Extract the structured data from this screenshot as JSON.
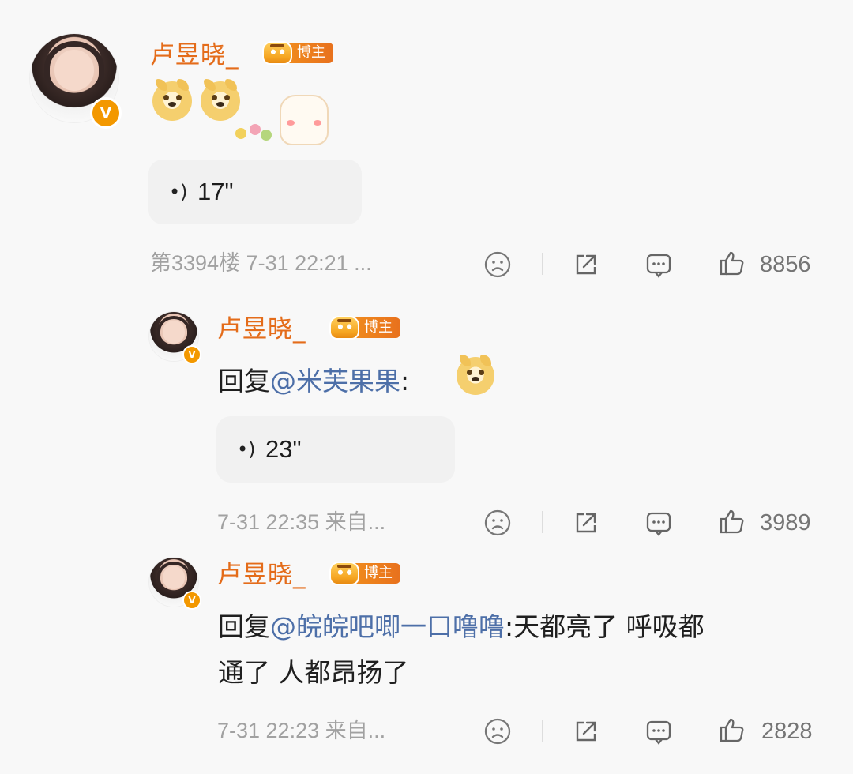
{
  "comments": [
    {
      "username": "卢昱晓_",
      "badge": "博主",
      "voice_duration": "17\"",
      "meta": "第3394楼 7-31 22:21 ...",
      "likes": "8856",
      "icons": [
        "dislike-icon",
        "share-icon",
        "comment-icon",
        "like-icon"
      ],
      "stickers": [
        "doge-emoji",
        "doge-emoji",
        "cat-sticker",
        "flower-sticker"
      ]
    },
    {
      "username": "卢昱晓_",
      "badge": "博主",
      "reply_prefix": "回复",
      "mention": "@米芙果果",
      "reply_tail": ":",
      "voice_duration": "23\"",
      "meta": "7-31 22:35 来自...",
      "likes": "3989",
      "icons": [
        "dislike-icon",
        "share-icon",
        "comment-icon",
        "like-icon"
      ],
      "stickers": [
        "doge-emoji"
      ]
    },
    {
      "username": "卢昱晓_",
      "badge": "博主",
      "reply_prefix": "回复",
      "mention": "@皖皖吧唧一口噜噜",
      "reply_tail": ":天都亮了 呼吸都",
      "reply_line2": "通了 人都昂扬了",
      "meta": "7-31 22:23 来自...",
      "likes": "2828",
      "icons": [
        "dislike-icon",
        "share-icon",
        "comment-icon",
        "like-icon"
      ]
    }
  ]
}
